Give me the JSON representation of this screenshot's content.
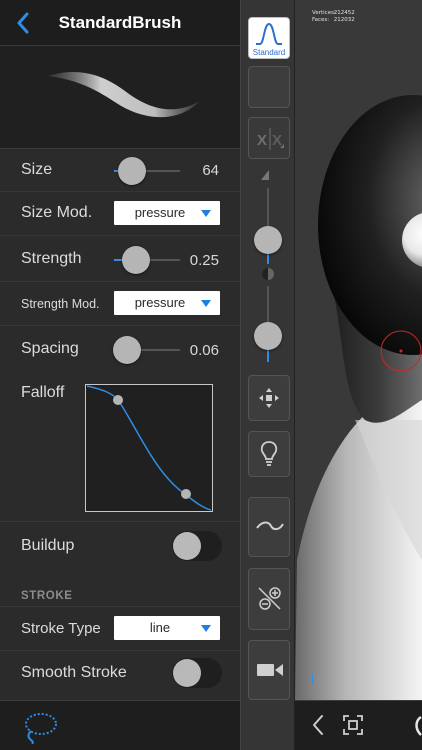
{
  "header": {
    "title": "StandardBrush"
  },
  "brush_settings": {
    "size": {
      "label": "Size",
      "value": "64",
      "fraction": 0.3
    },
    "size_mod": {
      "label": "Size Mod.",
      "value": "pressure"
    },
    "strength": {
      "label": "Strength",
      "value": "0.25",
      "fraction": 0.35
    },
    "strength_mod": {
      "label": "Strength Mod.",
      "value": "pressure"
    },
    "spacing": {
      "label": "Spacing",
      "value": "0.06",
      "fraction": 0.15
    },
    "falloff": {
      "label": "Falloff"
    },
    "buildup": {
      "label": "Buildup",
      "on": false
    }
  },
  "stroke_section": {
    "header": "STROKE",
    "stroke_type": {
      "label": "Stroke Type",
      "value": "line"
    },
    "smooth_stroke": {
      "label": "Smooth Stroke",
      "on": false
    }
  },
  "toolbar": {
    "brush_button_label": "Standard",
    "top_slider_fraction": 0.7,
    "bottom_slider_fraction": 0.35,
    "icons": [
      "standard-brush-icon",
      "symmetry-icon",
      "move-arrows-icon",
      "lightbulb-icon",
      "stroke-curve-icon",
      "mask-icon",
      "camera-icon"
    ]
  },
  "viewport": {
    "vertices_label": "Vertices:",
    "vertices_value": "212452",
    "faces_label": "Faces:",
    "faces_value": "212032"
  },
  "colors": {
    "accent": "#2f8de4",
    "panel_bg": "#2b2b2b",
    "cursor_ring": "#c62828"
  }
}
